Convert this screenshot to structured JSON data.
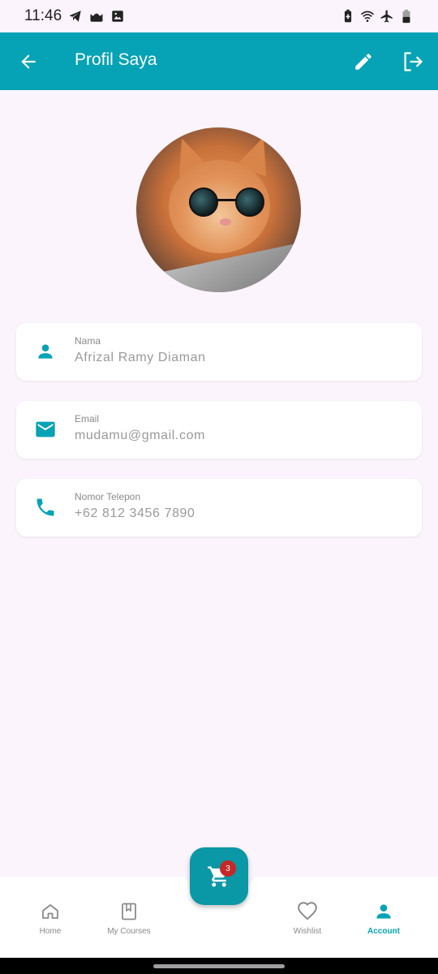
{
  "status_bar": {
    "time": "11:46"
  },
  "app_bar": {
    "title": "Profil Saya"
  },
  "profile": {
    "fields": [
      {
        "label": "Nama",
        "value": "Afrizal Ramy Diaman",
        "icon": "person-icon"
      },
      {
        "label": "Email",
        "value": "mudamu@gmail.com",
        "icon": "email-icon"
      },
      {
        "label": "Nomor Telepon",
        "value": "+62 812 3456 7890",
        "icon": "phone-icon"
      }
    ]
  },
  "cart": {
    "badge_count": "3"
  },
  "bottom_nav": {
    "items": [
      {
        "label": "Home",
        "icon": "home-icon",
        "active": false
      },
      {
        "label": "My Courses",
        "icon": "book-icon",
        "active": false
      },
      {
        "label": "Wishlist",
        "icon": "heart-icon",
        "active": false
      },
      {
        "label": "Account",
        "icon": "person-icon",
        "active": true
      }
    ]
  },
  "colors": {
    "primary": "#05a3b5",
    "background": "#fcf4fc",
    "badge": "#c62828",
    "inactive": "#8a8a8a"
  }
}
